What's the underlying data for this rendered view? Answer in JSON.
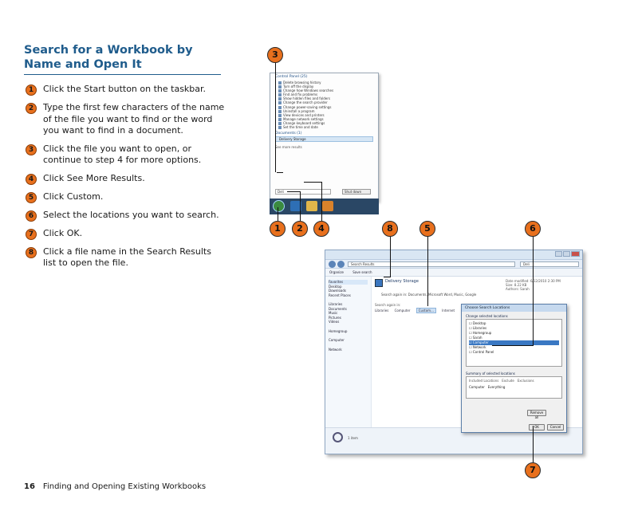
{
  "section": {
    "title": "Search for a Workbook by Name and Open It"
  },
  "steps": [
    {
      "num": "1",
      "text": "Click the Start button on the taskbar."
    },
    {
      "num": "2",
      "text": "Type the first few characters of the name of the file you want to find or the word you want to find in a document."
    },
    {
      "num": "3",
      "text": "Click the file you want to open, or continue to step 4 for more options."
    },
    {
      "num": "4",
      "text": "Click See More Results."
    },
    {
      "num": "5",
      "text": "Click Custom."
    },
    {
      "num": "6",
      "text": "Select the locations you want to search."
    },
    {
      "num": "7",
      "text": "Click OK."
    },
    {
      "num": "8",
      "text": "Click a file name in the Search Results list to open the file."
    }
  ],
  "callouts": {
    "c1": "1",
    "c2": "2",
    "c3": "3",
    "c4": "4",
    "c5": "5",
    "c6": "6",
    "c7": "7",
    "c8": "8"
  },
  "footer": {
    "page_number": "16",
    "chapter": "Finding and Opening Existing Workbooks"
  },
  "colors": {
    "heading": "#1f5c8c",
    "step_marker": "#e8701d"
  },
  "start_menu": {
    "panel_header": "Control Panel (25)",
    "items": [
      "Delete browsing history",
      "Turn off the display",
      "Change how Windows searches",
      "Find and fix problems",
      "Show hidden files and folders",
      "Change the search provider",
      "Change power-saving settings",
      "Uninstall a program",
      "View devices and printers",
      "Manage network settings",
      "Change keyboard settings",
      "Set the time and date"
    ],
    "docs_header": "Documents (1)",
    "file": "Delivery Storage",
    "see_more": "See more results",
    "search_value": "Deli",
    "shutdown": "Shut down"
  },
  "explorer": {
    "address": "Search Results",
    "search_value": "Deli",
    "toolbar": [
      "Organize",
      "Save search"
    ],
    "nav": [
      "Favorites",
      "Desktop",
      "Downloads",
      "Recent Places",
      "Libraries",
      "Documents",
      "Music",
      "Pictures",
      "Videos",
      "Homegroup",
      "Computer",
      "Network"
    ],
    "result_name": "Delivery Storage",
    "result_meta": [
      "Date modified: 6/12/2010 2:30 PM",
      "Size: 8.22 KB",
      "Authors: Sarah"
    ],
    "message": "Search again in: Documents, Microsoft Word, Music, Google",
    "again_label": "Search again in:",
    "locations": [
      "Libraries",
      "Computer",
      "Custom...",
      "Internet"
    ],
    "status": "1 item"
  },
  "dialog": {
    "title": "Choose Search Locations",
    "change_label": "Change selected locations",
    "tree": [
      "Desktop",
      "Libraries",
      "Homegroup",
      "Sarah",
      "Computer",
      "Network",
      "Control Panel"
    ],
    "summary_label": "Summary of selected locations",
    "summary_cols": [
      "Included Locations",
      "Exclude",
      "Exclusions"
    ],
    "summary_row": [
      "Computer",
      "Everything"
    ],
    "buttons": {
      "ok": "OK",
      "cancel": "Cancel",
      "remove": "Remove all"
    }
  }
}
